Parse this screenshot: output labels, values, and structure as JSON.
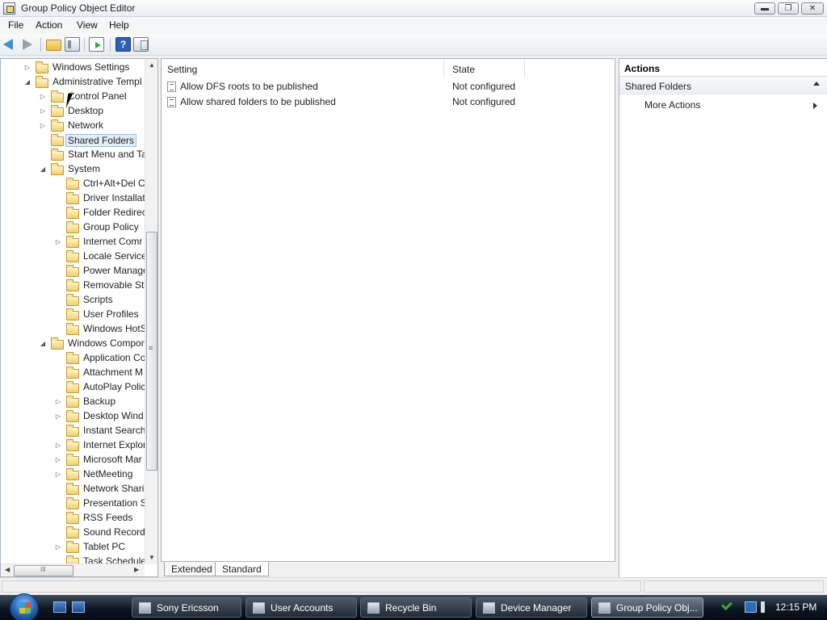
{
  "window": {
    "title": "Group Policy Object Editor",
    "buttons": {
      "minimize": "▬",
      "maximize": "❐",
      "close": "✕"
    }
  },
  "menu": [
    "File",
    "Action",
    "View",
    "Help"
  ],
  "toolbar": {
    "icons": [
      "back-arrow-icon",
      "forward-arrow-icon",
      "up-folder-icon",
      "show-hide-tree-icon",
      "export-list-icon",
      "help-icon",
      "properties-icon"
    ],
    "help_glyph": "?"
  },
  "tree": {
    "items": [
      {
        "label": "Windows Settings",
        "level": 1,
        "expander": "▷",
        "selected": false
      },
      {
        "label": "Administrative Templ",
        "level": 1,
        "expander": "◢",
        "selected": false
      },
      {
        "label": "Control Panel",
        "level": 2,
        "expander": "▷",
        "selected": false
      },
      {
        "label": "Desktop",
        "level": 2,
        "expander": "▷",
        "selected": false
      },
      {
        "label": "Network",
        "level": 2,
        "expander": "▷",
        "selected": false
      },
      {
        "label": "Shared Folders",
        "level": 2,
        "expander": "",
        "selected": true
      },
      {
        "label": "Start Menu and Ta",
        "level": 2,
        "expander": "",
        "selected": false
      },
      {
        "label": "System",
        "level": 2,
        "expander": "◢",
        "selected": false
      },
      {
        "label": "Ctrl+Alt+Del C",
        "level": 3,
        "expander": "",
        "selected": false
      },
      {
        "label": "Driver Installat",
        "level": 3,
        "expander": "",
        "selected": false
      },
      {
        "label": "Folder Redirec",
        "level": 3,
        "expander": "",
        "selected": false
      },
      {
        "label": "Group Policy",
        "level": 3,
        "expander": "",
        "selected": false
      },
      {
        "label": "Internet Comr",
        "level": 3,
        "expander": "▷",
        "selected": false
      },
      {
        "label": "Locale Service",
        "level": 3,
        "expander": "",
        "selected": false
      },
      {
        "label": "Power Manage",
        "level": 3,
        "expander": "",
        "selected": false
      },
      {
        "label": "Removable Sto",
        "level": 3,
        "expander": "",
        "selected": false
      },
      {
        "label": "Scripts",
        "level": 3,
        "expander": "",
        "selected": false
      },
      {
        "label": "User Profiles",
        "level": 3,
        "expander": "",
        "selected": false
      },
      {
        "label": "Windows HotS",
        "level": 3,
        "expander": "",
        "selected": false
      },
      {
        "label": "Windows Compor",
        "level": 2,
        "expander": "◢",
        "selected": false
      },
      {
        "label": "Application Co",
        "level": 3,
        "expander": "",
        "selected": false
      },
      {
        "label": "Attachment M",
        "level": 3,
        "expander": "",
        "selected": false
      },
      {
        "label": "AutoPlay Polic",
        "level": 3,
        "expander": "",
        "selected": false
      },
      {
        "label": "Backup",
        "level": 3,
        "expander": "▷",
        "selected": false
      },
      {
        "label": "Desktop Wind",
        "level": 3,
        "expander": "▷",
        "selected": false
      },
      {
        "label": "Instant Search",
        "level": 3,
        "expander": "",
        "selected": false
      },
      {
        "label": "Internet Explor",
        "level": 3,
        "expander": "▷",
        "selected": false
      },
      {
        "label": "Microsoft Mar",
        "level": 3,
        "expander": "▷",
        "selected": false
      },
      {
        "label": "NetMeeting",
        "level": 3,
        "expander": "▷",
        "selected": false
      },
      {
        "label": "Network Shari",
        "level": 3,
        "expander": "",
        "selected": false
      },
      {
        "label": "Presentation S",
        "level": 3,
        "expander": "",
        "selected": false
      },
      {
        "label": "RSS Feeds",
        "level": 3,
        "expander": "",
        "selected": false
      },
      {
        "label": "Sound Record",
        "level": 3,
        "expander": "",
        "selected": false
      },
      {
        "label": "Tablet PC",
        "level": 3,
        "expander": "▷",
        "selected": false
      },
      {
        "label": "Task Schedule",
        "level": 3,
        "expander": "",
        "selected": false
      }
    ],
    "scroll": {
      "up": "▲",
      "down": "▼",
      "left": "◀",
      "right": "▶",
      "grip_h": "III",
      "grip_v": "≡"
    }
  },
  "list": {
    "columns": [
      "Setting",
      "State"
    ],
    "rows": [
      {
        "setting": "Allow DFS roots to be published",
        "state": "Not configured"
      },
      {
        "setting": "Allow shared folders to be published",
        "state": "Not configured"
      }
    ],
    "tabs": [
      {
        "label": "Extended",
        "active": false
      },
      {
        "label": "Standard",
        "active": true
      }
    ]
  },
  "actions": {
    "title": "Actions",
    "group": "Shared Folders",
    "items": [
      "More Actions"
    ]
  },
  "taskbar": {
    "buttons": [
      {
        "label": "Sony Ericsson",
        "active": false
      },
      {
        "label": "User Accounts",
        "active": false
      },
      {
        "label": "Recycle Bin",
        "active": false
      },
      {
        "label": "Device Manager",
        "active": false
      },
      {
        "label": "Group Policy Obj...",
        "active": true
      }
    ],
    "clock": "12:15 PM"
  }
}
